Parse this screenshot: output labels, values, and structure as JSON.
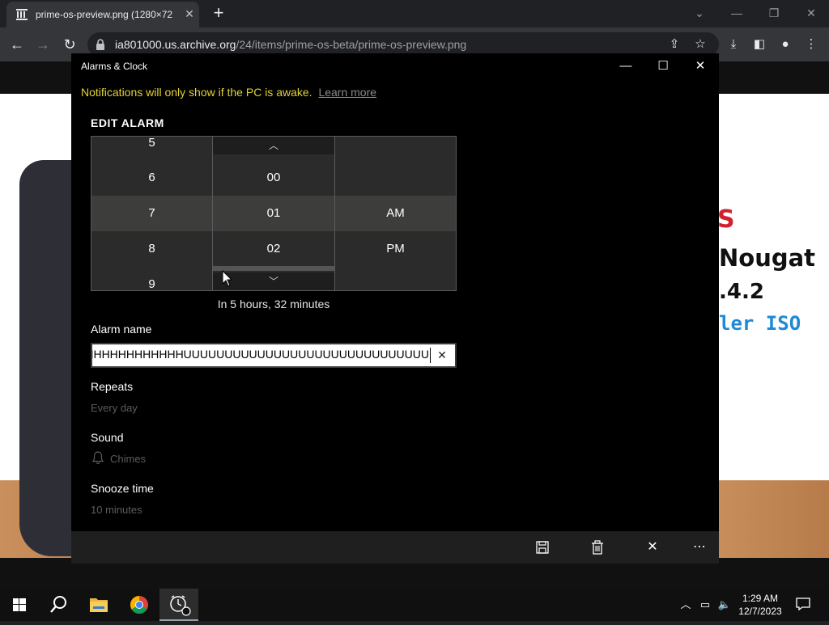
{
  "browser": {
    "tab_title": "prime-os-preview.png (1280×72",
    "tab_close": "✕",
    "new_tab": "+",
    "url_domain": "ia801000.us.archive.org",
    "url_path": "/24/items/prime-os-beta/prime-os-preview.png"
  },
  "page_bg": {
    "line1": "S",
    "line2": "Nougat",
    "line3": ".4.2",
    "line4": "ler ISO"
  },
  "app": {
    "title": "Alarms & Clock",
    "notice": "Notifications will only show if the PC is awake.",
    "learn_more": "Learn more",
    "edit_heading": "EDIT ALARM",
    "hours": [
      "5",
      "6",
      "7",
      "8",
      "9"
    ],
    "minutes": [
      "00",
      "01",
      "02"
    ],
    "periods": [
      "AM",
      "PM"
    ],
    "until": "In 5 hours, 32 minutes",
    "alarm_name_label": "Alarm name",
    "alarm_name_value": "HHHHHHHHHHHHHHHHHHHUUUUUUUUUUUUUUUUUUUUUUUUUUUUUU",
    "repeats_label": "Repeats",
    "repeats_value": "Every day",
    "sound_label": "Sound",
    "sound_value": "Chimes",
    "snooze_label": "Snooze time",
    "snooze_value": "10 minutes"
  },
  "taskbar": {
    "time": "1:29 AM",
    "date": "12/7/2023"
  },
  "colors": {
    "notice": "#e3d235",
    "selected_row": "#3d3d3b"
  }
}
